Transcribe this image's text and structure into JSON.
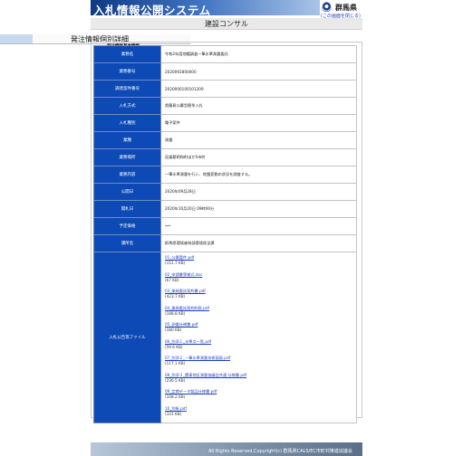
{
  "header": {
    "title": "入札情報公開システム",
    "logo_text": "群馬県",
    "logo_link": "(この画面を閉じる)",
    "company": "建設コンサル"
  },
  "section": {
    "title": "発注情報個別詳細",
    "caption": "発注情報基本情報"
  },
  "rows": [
    {
      "label": "業務名",
      "value": "令和2年度地籍調査一筆水準測量委託"
    },
    {
      "label": "業務番号",
      "value": "2020092800000"
    },
    {
      "label": "調達案件番号",
      "value": "2020000100101209"
    },
    {
      "label": "入札方式",
      "value": "県簡易公募型競争入札"
    },
    {
      "label": "入札種別",
      "value": "電子案件"
    },
    {
      "label": "業種",
      "value": "測量"
    },
    {
      "label": "業務場所",
      "value": "邑楽郡明和町ほか5市町"
    },
    {
      "label": "業務内容",
      "value": "一筆水準測量を行い、地盤変動の状況を調査する。"
    },
    {
      "label": "公開日",
      "value": "2020年09月28日"
    },
    {
      "label": "開札日",
      "value": "2020年10月20日 09時00分"
    },
    {
      "label": "予定価格",
      "value": "***"
    },
    {
      "label": "課所名",
      "value": "群馬県環境森林部環境保全課"
    }
  ],
  "files": {
    "label": "入札公告等ファイル",
    "items": [
      {
        "name": "01_公募要件.pdf",
        "size": "(151.7 KB)"
      },
      {
        "name": "02_申請書等様式.doc",
        "size": "(67 KB)"
      },
      {
        "name": "03_業務委託契約書.pdf",
        "size": "(423.7 KB)"
      },
      {
        "name": "04_業務委託契約約款.pdf",
        "size": "(188.8 KB)"
      },
      {
        "name": "05_測量仕様書.pdf",
        "size": "(180 KB)"
      },
      {
        "name": "06_別添１_水準点一覧.pdf",
        "size": "(59.6 KB)"
      },
      {
        "name": "07_別添２_一筆水準測量技術図面.pdf",
        "size": "(117.1 KB)"
      },
      {
        "name": "08_別添３_関東地区測量協議会共通 仕様書.pdf",
        "size": "(236.5 KB)"
      },
      {
        "name": "09_定期データ製品仕様書.pdf",
        "size": "(108.2 KB)"
      },
      {
        "name": "10_別紙.pdf",
        "size": "(101 KB)"
      }
    ]
  },
  "footer": {
    "text": "All Rights Reserved,Copyright(c) 群馬県CALS/EC市町村推進協議会"
  }
}
